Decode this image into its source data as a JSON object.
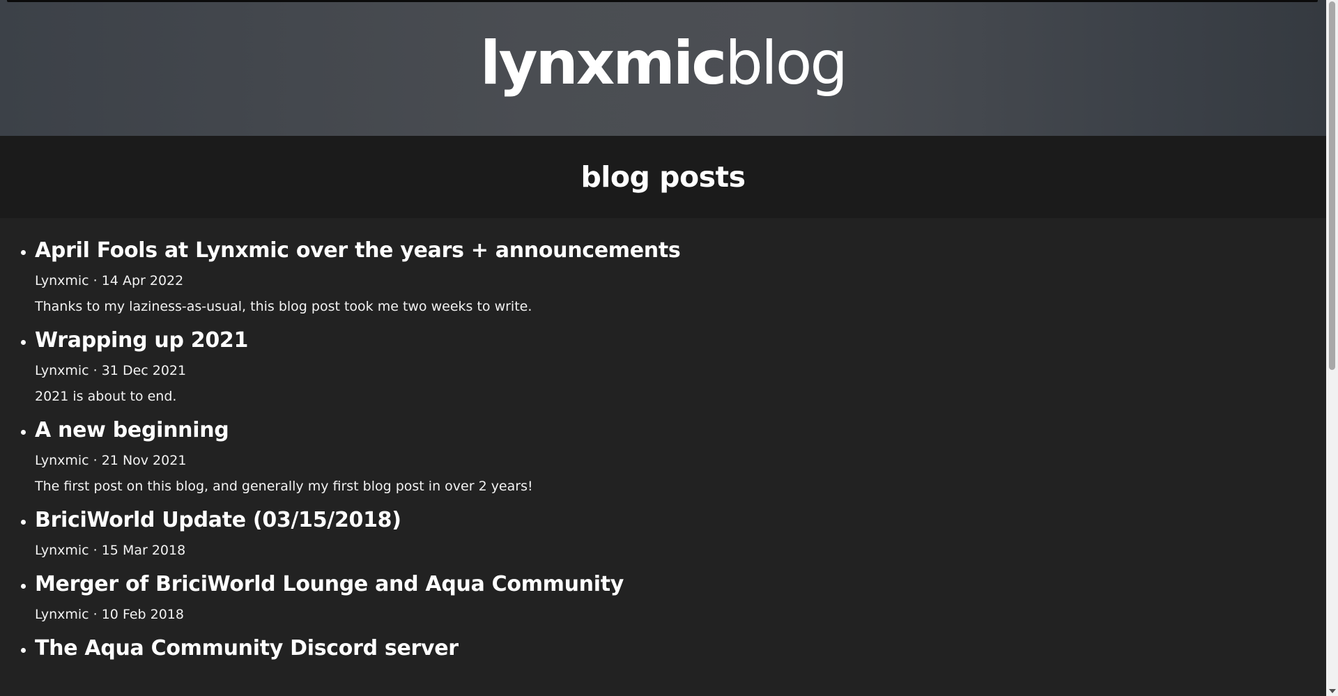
{
  "header": {
    "logo_bold": "lynxmic",
    "logo_light": "blog"
  },
  "section": {
    "title": "blog posts"
  },
  "posts": [
    {
      "title": "April Fools at Lynxmic over the years + announcements",
      "meta": "Lynxmic · 14 Apr 2022",
      "excerpt": "Thanks to my laziness-as-usual, this blog post took me two weeks to write."
    },
    {
      "title": "Wrapping up 2021",
      "meta": "Lynxmic · 31 Dec 2021",
      "excerpt": "2021 is about to end."
    },
    {
      "title": "A new beginning",
      "meta": "Lynxmic · 21 Nov 2021",
      "excerpt": "The first post on this blog, and generally my first blog post in over 2 years!"
    },
    {
      "title": "BriciWorld Update (03/15/2018)",
      "meta": "Lynxmic · 15 Mar 2018"
    },
    {
      "title": "Merger of BriciWorld Lounge and Aqua Community",
      "meta": "Lynxmic · 10 Feb 2018"
    },
    {
      "title": "The Aqua Community Discord server"
    }
  ],
  "scrollbar": {
    "position_fraction": 0.0,
    "visible_fraction": 0.54
  }
}
